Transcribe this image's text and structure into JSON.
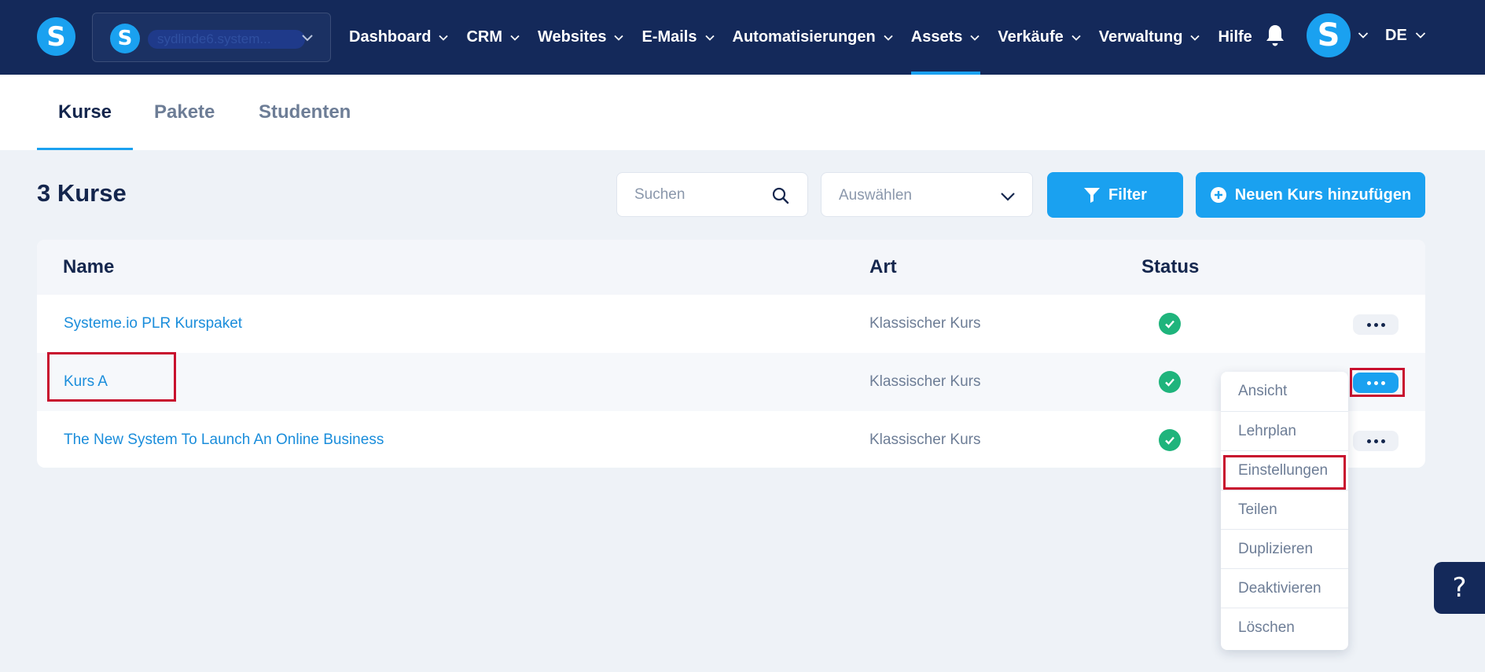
{
  "brand": {
    "logo_letter": "S",
    "avatar_letter": "S"
  },
  "account": {
    "name": "sydlinde6.system...",
    "logo_letter": "S"
  },
  "nav": {
    "items": [
      {
        "label": "Dashboard",
        "caret": true
      },
      {
        "label": "CRM",
        "caret": true
      },
      {
        "label": "Websites",
        "caret": true
      },
      {
        "label": "E-Mails",
        "caret": true
      },
      {
        "label": "Automatisierungen",
        "caret": true
      },
      {
        "label": "Assets",
        "caret": true,
        "active": true
      },
      {
        "label": "Verkäufe",
        "caret": true
      },
      {
        "label": "Verwaltung",
        "caret": true
      },
      {
        "label": "Hilfe",
        "caret": false
      }
    ],
    "language": "DE"
  },
  "subtabs": [
    {
      "label": "Kurse",
      "active": true
    },
    {
      "label": "Pakete"
    },
    {
      "label": "Studenten"
    }
  ],
  "page_title": "3 Kurse",
  "search": {
    "placeholder": "Suchen",
    "value": ""
  },
  "select": {
    "placeholder": "Auswählen"
  },
  "buttons": {
    "filter": "Filter",
    "add_course": "Neuen Kurs hinzufügen"
  },
  "table": {
    "columns": {
      "name": "Name",
      "art": "Art",
      "status": "Status"
    },
    "rows": [
      {
        "name": "Systeme.io PLR Kurspaket",
        "art": "Klassischer Kurs",
        "status": "active"
      },
      {
        "name": "Kurs A",
        "art": "Klassischer Kurs",
        "status": "active"
      },
      {
        "name": "The New System To Launch An Online Business",
        "art": "Klassischer Kurs",
        "status": "active"
      }
    ]
  },
  "menu": {
    "items": [
      "Ansicht",
      "Lehrplan",
      "Einstellungen",
      "Teilen",
      "Duplizieren",
      "Deaktivieren",
      "Löschen"
    ]
  },
  "help_label": "?",
  "colors": {
    "nav_bg": "#14295a",
    "accent": "#1aa1f0",
    "success": "#1fb47c",
    "highlight": "#c8102e"
  }
}
